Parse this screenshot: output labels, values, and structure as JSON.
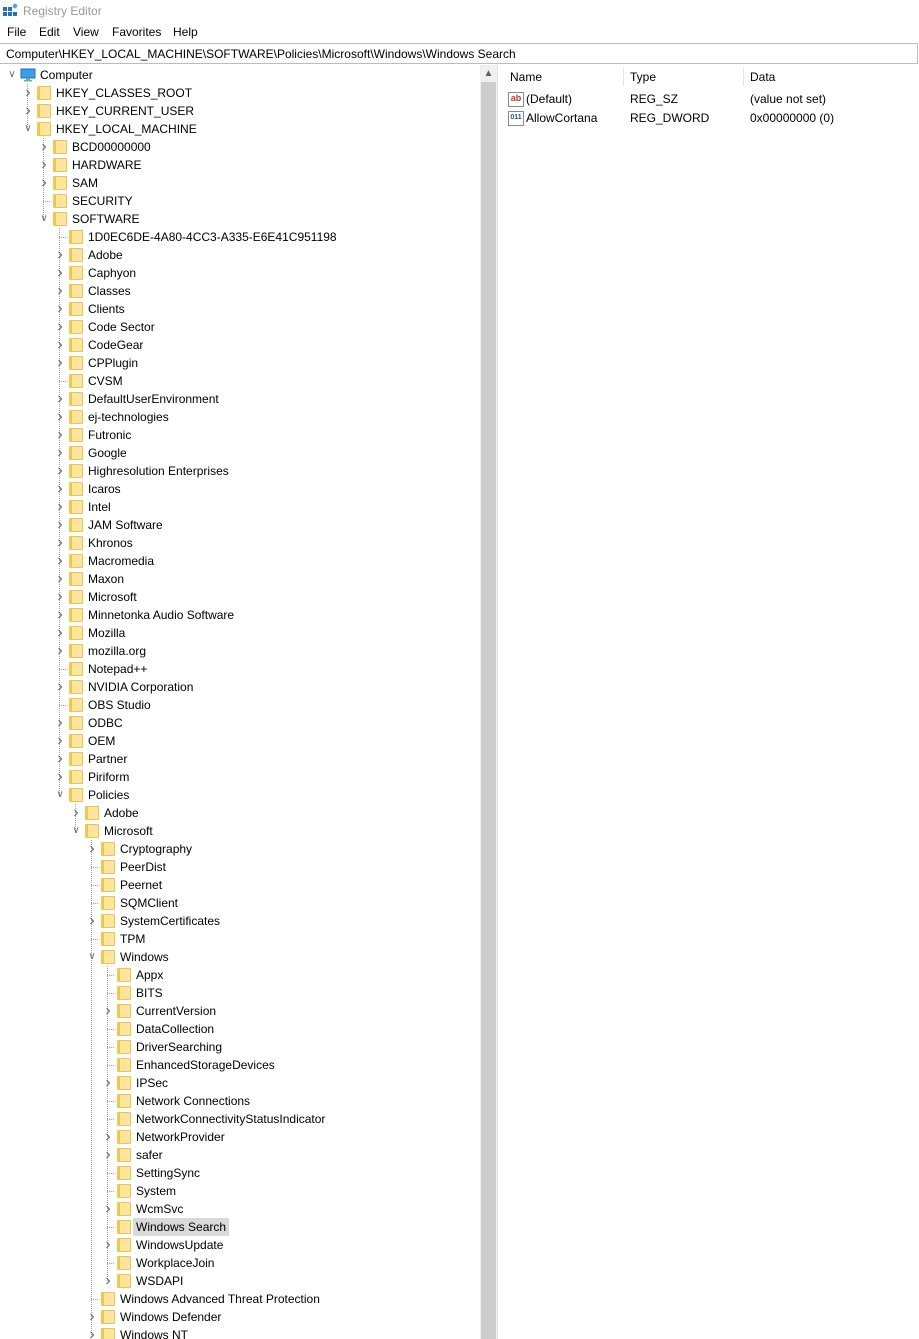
{
  "window": {
    "title": "Registry Editor"
  },
  "menu": [
    "File",
    "Edit",
    "View",
    "Favorites",
    "Help"
  ],
  "address": "Computer\\HKEY_LOCAL_MACHINE\\SOFTWARE\\Policies\\Microsoft\\Windows\\Windows Search",
  "tree": [
    {
      "label": "Computer",
      "level": 0,
      "state": "expanded",
      "icon": "computer-icon"
    },
    {
      "label": "HKEY_CLASSES_ROOT",
      "level": 1,
      "state": "collapsed"
    },
    {
      "label": "HKEY_CURRENT_USER",
      "level": 1,
      "state": "collapsed"
    },
    {
      "label": "HKEY_LOCAL_MACHINE",
      "level": 1,
      "state": "expanded"
    },
    {
      "label": "BCD00000000",
      "level": 2,
      "state": "collapsed"
    },
    {
      "label": "HARDWARE",
      "level": 2,
      "state": "collapsed"
    },
    {
      "label": "SAM",
      "level": 2,
      "state": "collapsed"
    },
    {
      "label": "SECURITY",
      "level": 2,
      "state": "leaf"
    },
    {
      "label": "SOFTWARE",
      "level": 2,
      "state": "expanded"
    },
    {
      "label": "1D0EC6DE-4A80-4CC3-A335-E6E41C951198",
      "level": 3,
      "state": "leaf"
    },
    {
      "label": "Adobe",
      "level": 3,
      "state": "collapsed"
    },
    {
      "label": "Caphyon",
      "level": 3,
      "state": "collapsed"
    },
    {
      "label": "Classes",
      "level": 3,
      "state": "collapsed"
    },
    {
      "label": "Clients",
      "level": 3,
      "state": "collapsed"
    },
    {
      "label": "Code Sector",
      "level": 3,
      "state": "collapsed"
    },
    {
      "label": "CodeGear",
      "level": 3,
      "state": "collapsed"
    },
    {
      "label": "CPPlugin",
      "level": 3,
      "state": "collapsed"
    },
    {
      "label": "CVSM",
      "level": 3,
      "state": "leaf"
    },
    {
      "label": "DefaultUserEnvironment",
      "level": 3,
      "state": "collapsed"
    },
    {
      "label": "ej-technologies",
      "level": 3,
      "state": "collapsed"
    },
    {
      "label": "Futronic",
      "level": 3,
      "state": "collapsed"
    },
    {
      "label": "Google",
      "level": 3,
      "state": "collapsed"
    },
    {
      "label": "Highresolution Enterprises",
      "level": 3,
      "state": "collapsed"
    },
    {
      "label": "Icaros",
      "level": 3,
      "state": "collapsed"
    },
    {
      "label": "Intel",
      "level": 3,
      "state": "collapsed"
    },
    {
      "label": "JAM Software",
      "level": 3,
      "state": "collapsed"
    },
    {
      "label": "Khronos",
      "level": 3,
      "state": "collapsed"
    },
    {
      "label": "Macromedia",
      "level": 3,
      "state": "collapsed"
    },
    {
      "label": "Maxon",
      "level": 3,
      "state": "collapsed"
    },
    {
      "label": "Microsoft",
      "level": 3,
      "state": "collapsed"
    },
    {
      "label": "Minnetonka Audio Software",
      "level": 3,
      "state": "collapsed"
    },
    {
      "label": "Mozilla",
      "level": 3,
      "state": "collapsed"
    },
    {
      "label": "mozilla.org",
      "level": 3,
      "state": "collapsed"
    },
    {
      "label": "Notepad++",
      "level": 3,
      "state": "leaf"
    },
    {
      "label": "NVIDIA Corporation",
      "level": 3,
      "state": "collapsed"
    },
    {
      "label": "OBS Studio",
      "level": 3,
      "state": "leaf"
    },
    {
      "label": "ODBC",
      "level": 3,
      "state": "collapsed"
    },
    {
      "label": "OEM",
      "level": 3,
      "state": "collapsed"
    },
    {
      "label": "Partner",
      "level": 3,
      "state": "collapsed"
    },
    {
      "label": "Piriform",
      "level": 3,
      "state": "collapsed"
    },
    {
      "label": "Policies",
      "level": 3,
      "state": "expanded"
    },
    {
      "label": "Adobe",
      "level": 4,
      "state": "collapsed"
    },
    {
      "label": "Microsoft",
      "level": 4,
      "state": "expanded"
    },
    {
      "label": "Cryptography",
      "level": 5,
      "state": "collapsed"
    },
    {
      "label": "PeerDist",
      "level": 5,
      "state": "leaf"
    },
    {
      "label": "Peernet",
      "level": 5,
      "state": "leaf"
    },
    {
      "label": "SQMClient",
      "level": 5,
      "state": "leaf"
    },
    {
      "label": "SystemCertificates",
      "level": 5,
      "state": "collapsed"
    },
    {
      "label": "TPM",
      "level": 5,
      "state": "leaf"
    },
    {
      "label": "Windows",
      "level": 5,
      "state": "expanded"
    },
    {
      "label": "Appx",
      "level": 6,
      "state": "leaf"
    },
    {
      "label": "BITS",
      "level": 6,
      "state": "leaf"
    },
    {
      "label": "CurrentVersion",
      "level": 6,
      "state": "collapsed"
    },
    {
      "label": "DataCollection",
      "level": 6,
      "state": "leaf"
    },
    {
      "label": "DriverSearching",
      "level": 6,
      "state": "leaf"
    },
    {
      "label": "EnhancedStorageDevices",
      "level": 6,
      "state": "leaf"
    },
    {
      "label": "IPSec",
      "level": 6,
      "state": "collapsed"
    },
    {
      "label": "Network Connections",
      "level": 6,
      "state": "leaf"
    },
    {
      "label": "NetworkConnectivityStatusIndicator",
      "level": 6,
      "state": "leaf"
    },
    {
      "label": "NetworkProvider",
      "level": 6,
      "state": "collapsed"
    },
    {
      "label": "safer",
      "level": 6,
      "state": "collapsed"
    },
    {
      "label": "SettingSync",
      "level": 6,
      "state": "leaf"
    },
    {
      "label": "System",
      "level": 6,
      "state": "leaf"
    },
    {
      "label": "WcmSvc",
      "level": 6,
      "state": "collapsed"
    },
    {
      "label": "Windows Search",
      "level": 6,
      "state": "leaf",
      "selected": true
    },
    {
      "label": "WindowsUpdate",
      "level": 6,
      "state": "collapsed"
    },
    {
      "label": "WorkplaceJoin",
      "level": 6,
      "state": "leaf"
    },
    {
      "label": "WSDAPI",
      "level": 6,
      "state": "collapsed"
    },
    {
      "label": "Windows Advanced Threat Protection",
      "level": 5,
      "state": "leaf"
    },
    {
      "label": "Windows Defender",
      "level": 5,
      "state": "collapsed"
    },
    {
      "label": "Windows NT",
      "level": 5,
      "state": "collapsed"
    }
  ],
  "list": {
    "columns": [
      "Name",
      "Type",
      "Data"
    ],
    "rows": [
      {
        "name": "(Default)",
        "type": "REG_SZ",
        "data": "(value not set)",
        "icon": "string-value-icon",
        "glyph": "ab"
      },
      {
        "name": "AllowCortana",
        "type": "REG_DWORD",
        "data": "0x00000000 (0)",
        "icon": "binary-value-icon",
        "glyph": "011"
      }
    ]
  },
  "colors": {
    "folder": "#fde59a",
    "folder_edge": "#e8c55c",
    "selection": "#d9d9d9",
    "string_icon": "#c0392b",
    "binary_icon": "#1f4e9c"
  }
}
